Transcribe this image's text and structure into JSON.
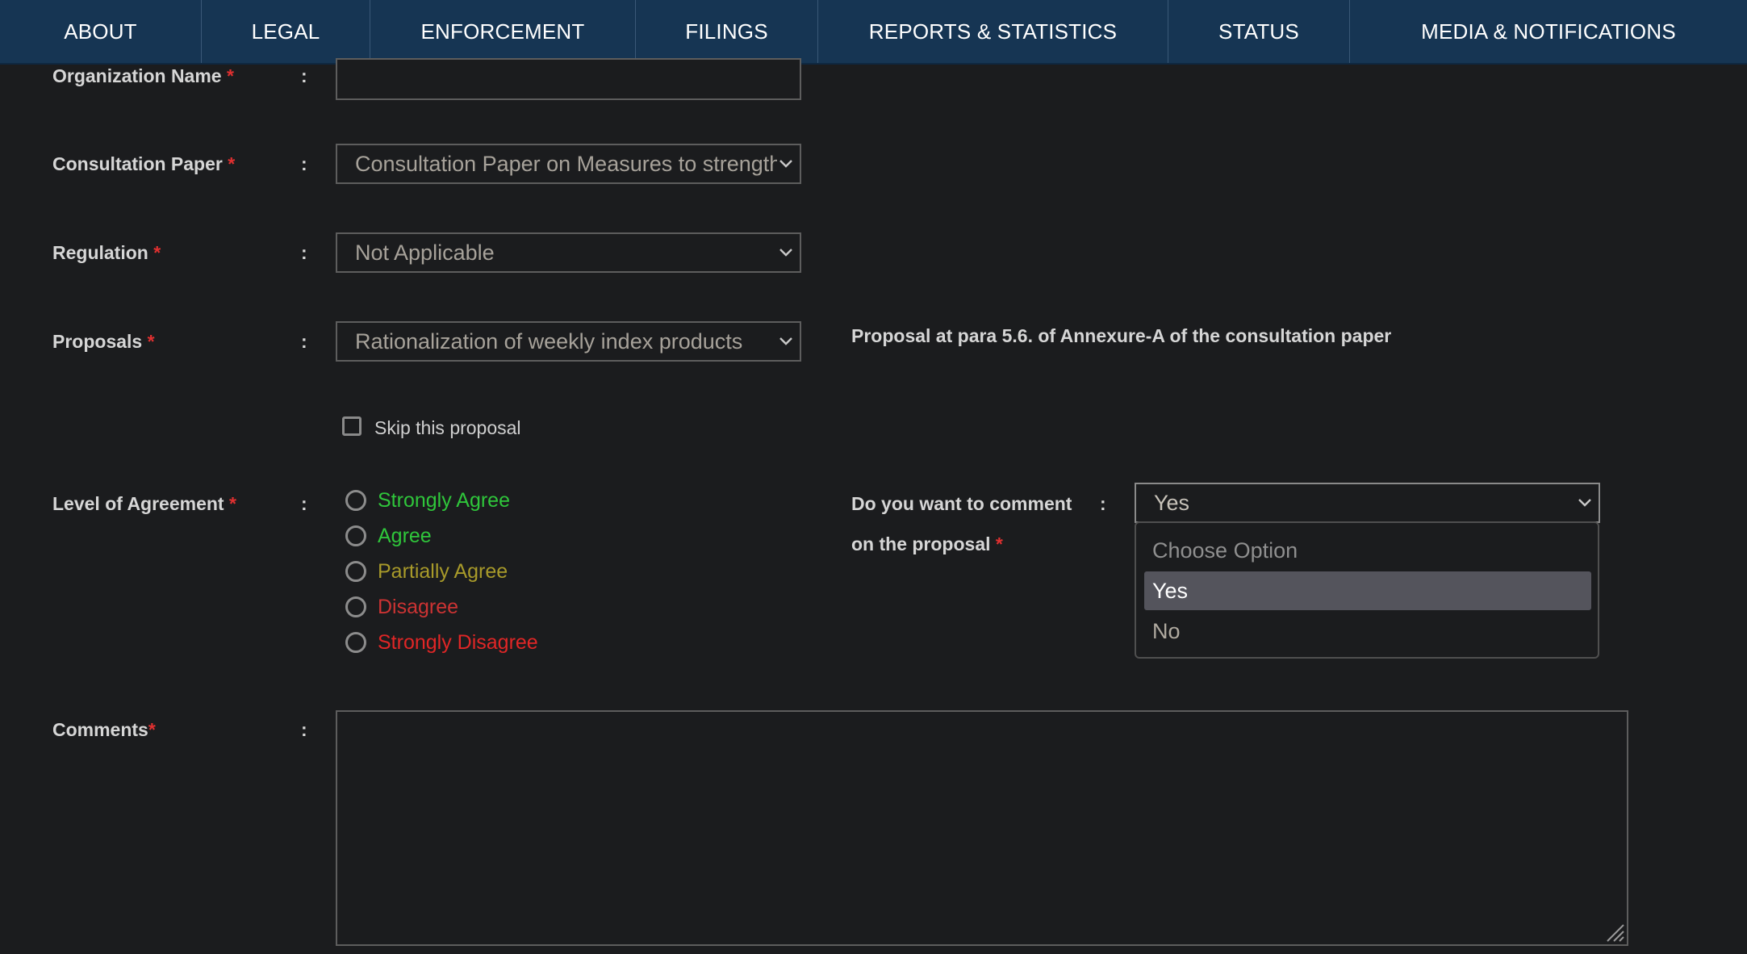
{
  "nav": {
    "items": [
      "ABOUT",
      "LEGAL",
      "ENFORCEMENT",
      "FILINGS",
      "REPORTS & STATISTICS",
      "STATUS",
      "MEDIA & NOTIFICATIONS"
    ]
  },
  "form": {
    "required_mark": "*",
    "colon": ":",
    "organization": {
      "label": "Organization Name",
      "value": ""
    },
    "consultation_paper": {
      "label": "Consultation Paper",
      "value": "Consultation Paper on Measures to strengthe"
    },
    "regulation": {
      "label": "Regulation",
      "value": "Not Applicable"
    },
    "proposals": {
      "label": "Proposals",
      "value": "Rationalization of weekly index products",
      "note": "Proposal at para 5.6. of Annexure-A of the consultation paper"
    },
    "skip": {
      "label": "Skip this proposal",
      "checked": false
    },
    "agreement": {
      "label": "Level of Agreement",
      "options": [
        {
          "label": "Strongly Agree",
          "color": "#2fc63b"
        },
        {
          "label": "Agree",
          "color": "#2fc63b"
        },
        {
          "label": "Partially Agree",
          "color": "#a89a2a"
        },
        {
          "label": "Disagree",
          "color": "#cc3333"
        },
        {
          "label": "Strongly Disagree",
          "color": "#e02626"
        }
      ]
    },
    "comment_choice": {
      "label_line1": "Do you want to comment",
      "label_line2": "on the proposal",
      "value": "Yes",
      "options": [
        "Choose Option",
        "Yes",
        "No"
      ],
      "selected": "Yes"
    },
    "comments": {
      "label": "Comments",
      "value": ""
    }
  },
  "colors": {
    "nav_bg": "#163553",
    "page_bg": "#1b1c1e",
    "required": "#e03030",
    "option_highlight": "#54545c"
  }
}
